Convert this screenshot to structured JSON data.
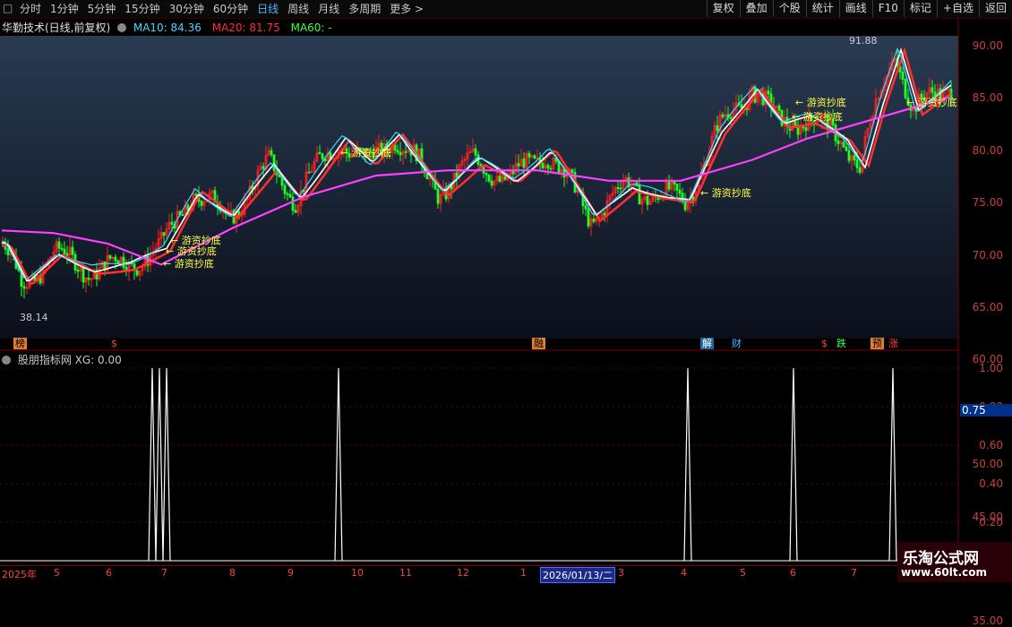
{
  "toolbar": {
    "periods": [
      "分时",
      "1分钟",
      "5分钟",
      "15分钟",
      "30分钟",
      "60分钟",
      "日线",
      "周线",
      "月线",
      "多周期",
      "更多 >"
    ],
    "active_period": "日线",
    "buttons": [
      "复权",
      "叠加",
      "个股",
      "统计",
      "画线",
      "F10",
      "标记",
      "+自选",
      "返回"
    ]
  },
  "main": {
    "title": "华勤技术(日线,前复权)",
    "ma10": "MA10: 84.36",
    "ma20": "MA20: 81.75",
    "ma60": "MA60: -",
    "high_label": "91.88",
    "low_label": "38.14",
    "y_ticks": [
      "90.00",
      "85.00",
      "80.00",
      "75.00",
      "70.00",
      "65.00",
      "60.00",
      "55.00",
      "50.00",
      "45.00",
      "40.00",
      "35.00"
    ],
    "signals": [
      "游资抄底",
      "游资抄底",
      "游资抄底",
      "游资抄底",
      "游资抄底",
      "游资抄底",
      "游资抄底",
      "游资抄底"
    ],
    "badges": [
      "榜",
      "$",
      "融",
      "解",
      "财",
      "$",
      "跌",
      "预",
      "涨"
    ]
  },
  "sub": {
    "title": "股朋指标网 XG: 0.00",
    "y_ticks": [
      "1.00",
      "0.80",
      "0.60",
      "0.40",
      "0.20"
    ],
    "current_value": "0.75"
  },
  "dates": [
    "2025年",
    "5",
    "6",
    "7",
    "8",
    "9",
    "10",
    "11",
    "12",
    "1",
    "2026/01/13/二",
    "3",
    "4",
    "5",
    "6",
    "7"
  ],
  "watermark": {
    "line1": "乐淘公式网",
    "line2": "www.60lt.com"
  },
  "colors": {
    "ma10": "#40d8ff",
    "ma20": "#ff3030",
    "ma60": "#ff40ff",
    "ma5": "#ffffff",
    "up": "#ff2020",
    "down": "#20ff20"
  }
}
